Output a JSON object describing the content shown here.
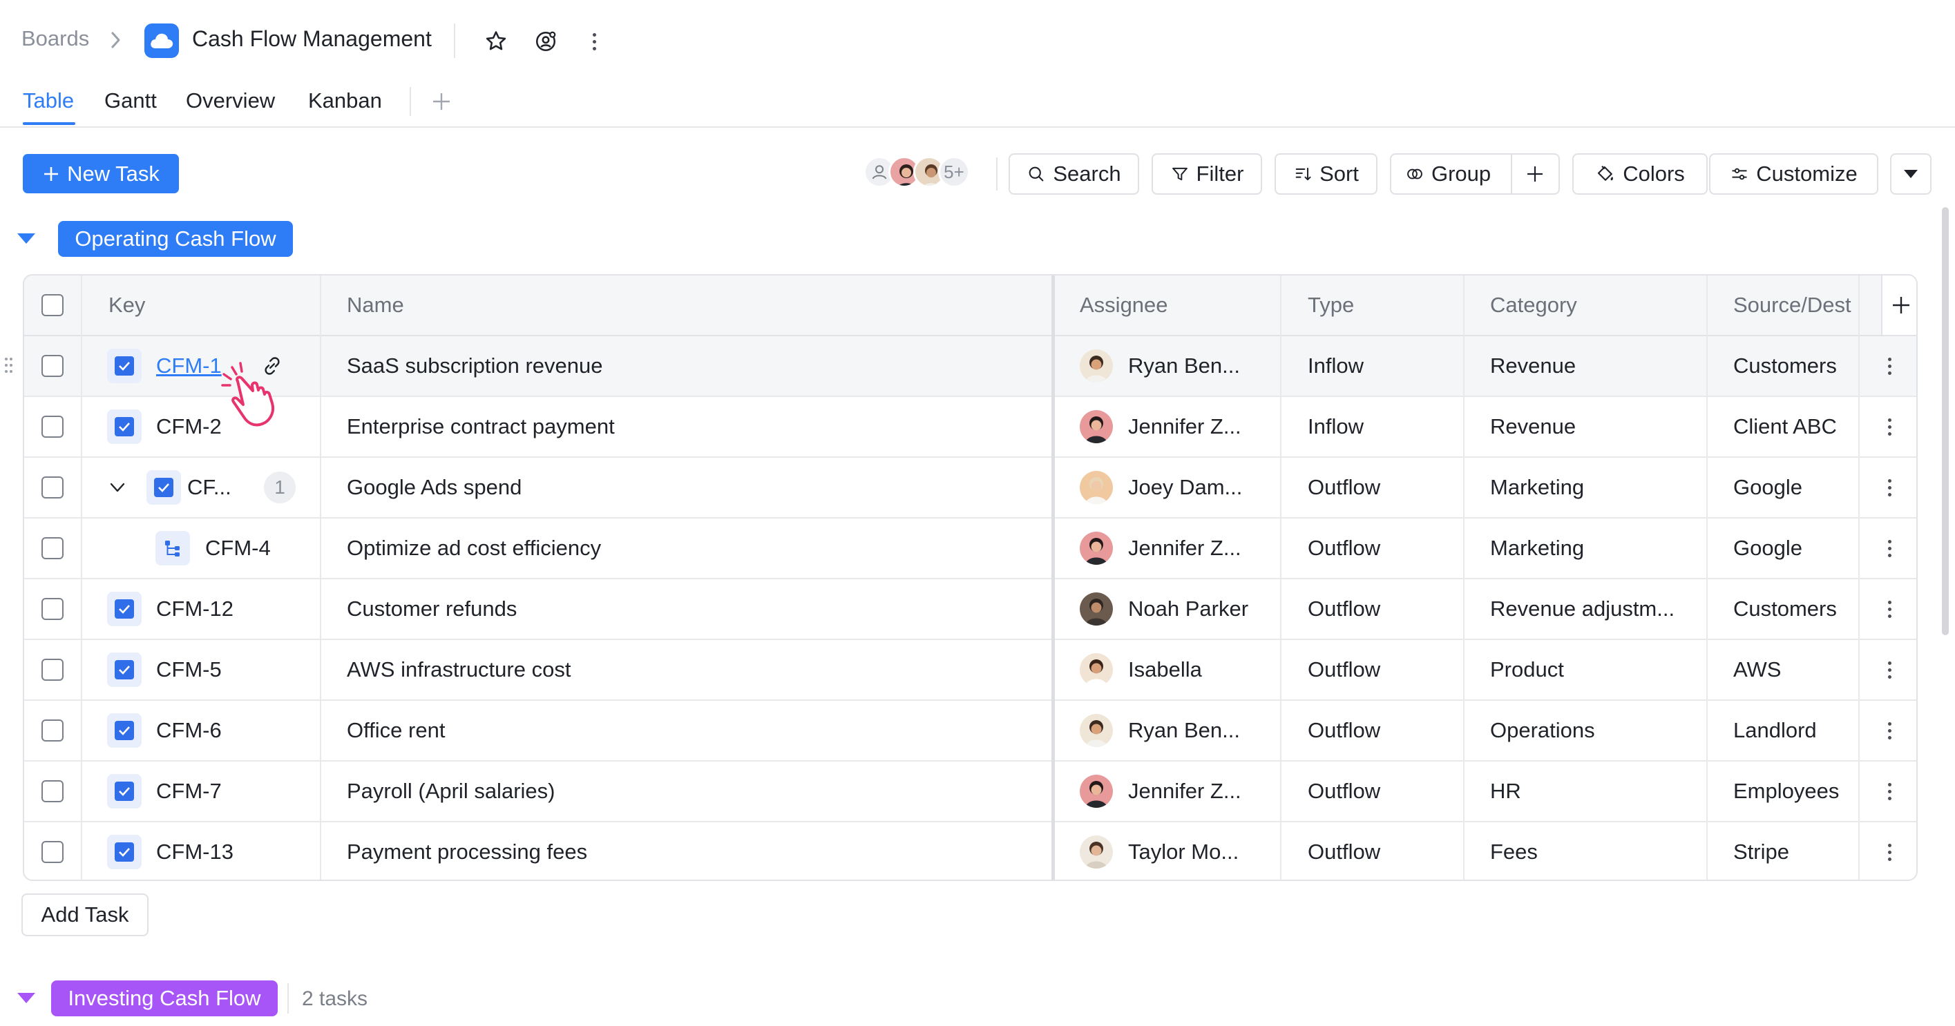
{
  "breadcrumb": {
    "root": "Boards",
    "board_title": "Cash Flow Management"
  },
  "tabs": [
    {
      "label": "Table",
      "active": true
    },
    {
      "label": "Gantt",
      "active": false
    },
    {
      "label": "Overview",
      "active": false
    },
    {
      "label": "Kanban",
      "active": false
    }
  ],
  "toolbar": {
    "new_task": "New Task",
    "members_more": "5+",
    "search": "Search",
    "filter": "Filter",
    "sort": "Sort",
    "group": "Group",
    "colors": "Colors",
    "customize": "Customize"
  },
  "colors": {
    "accent": "#2f7df6",
    "operating_group": "#2f7df6",
    "investing_group": "#a855f7",
    "cursor": "#e8336d"
  },
  "groups": {
    "operating": {
      "label": "Operating Cash Flow"
    },
    "investing": {
      "label": "Investing Cash Flow",
      "count_text": "2 tasks"
    }
  },
  "table": {
    "columns": {
      "key": "Key",
      "name": "Name",
      "assignee": "Assignee",
      "type": "Type",
      "category": "Category",
      "source": "Source/Dest"
    },
    "rows": [
      {
        "key": "CFM-1",
        "name": "SaaS subscription revenue",
        "assignee": "Ryan Ben...",
        "type": "Inflow",
        "category": "Revenue",
        "source": "Customers"
      },
      {
        "key": "CFM-2",
        "name": "Enterprise contract payment",
        "assignee": "Jennifer Z...",
        "type": "Inflow",
        "category": "Revenue",
        "source": "Client ABC"
      },
      {
        "key": "CF...",
        "subtask_count": "1",
        "name": "Google Ads spend",
        "assignee": "Joey Dam...",
        "type": "Outflow",
        "category": "Marketing",
        "source": "Google"
      },
      {
        "key": "CFM-4",
        "name": "Optimize ad cost efficiency",
        "assignee": "Jennifer Z...",
        "type": "Outflow",
        "category": "Marketing",
        "source": "Google"
      },
      {
        "key": "CFM-12",
        "name": "Customer refunds",
        "assignee": "Noah Parker",
        "type": "Outflow",
        "category": "Revenue adjustm...",
        "source": "Customers"
      },
      {
        "key": "CFM-5",
        "name": "AWS infrastructure cost",
        "assignee": "Isabella",
        "type": "Outflow",
        "category": "Product",
        "source": "AWS"
      },
      {
        "key": "CFM-6",
        "name": "Office rent",
        "assignee": "Ryan Ben...",
        "type": "Outflow",
        "category": "Operations",
        "source": "Landlord"
      },
      {
        "key": "CFM-7",
        "name": "Payroll (April salaries)",
        "assignee": "Jennifer Z...",
        "type": "Outflow",
        "category": "HR",
        "source": "Employees"
      },
      {
        "key": "CFM-13",
        "name": "Payment processing fees",
        "assignee": "Taylor Mo...",
        "type": "Outflow",
        "category": "Fees",
        "source": "Stripe"
      }
    ],
    "add_task": "Add Task"
  }
}
